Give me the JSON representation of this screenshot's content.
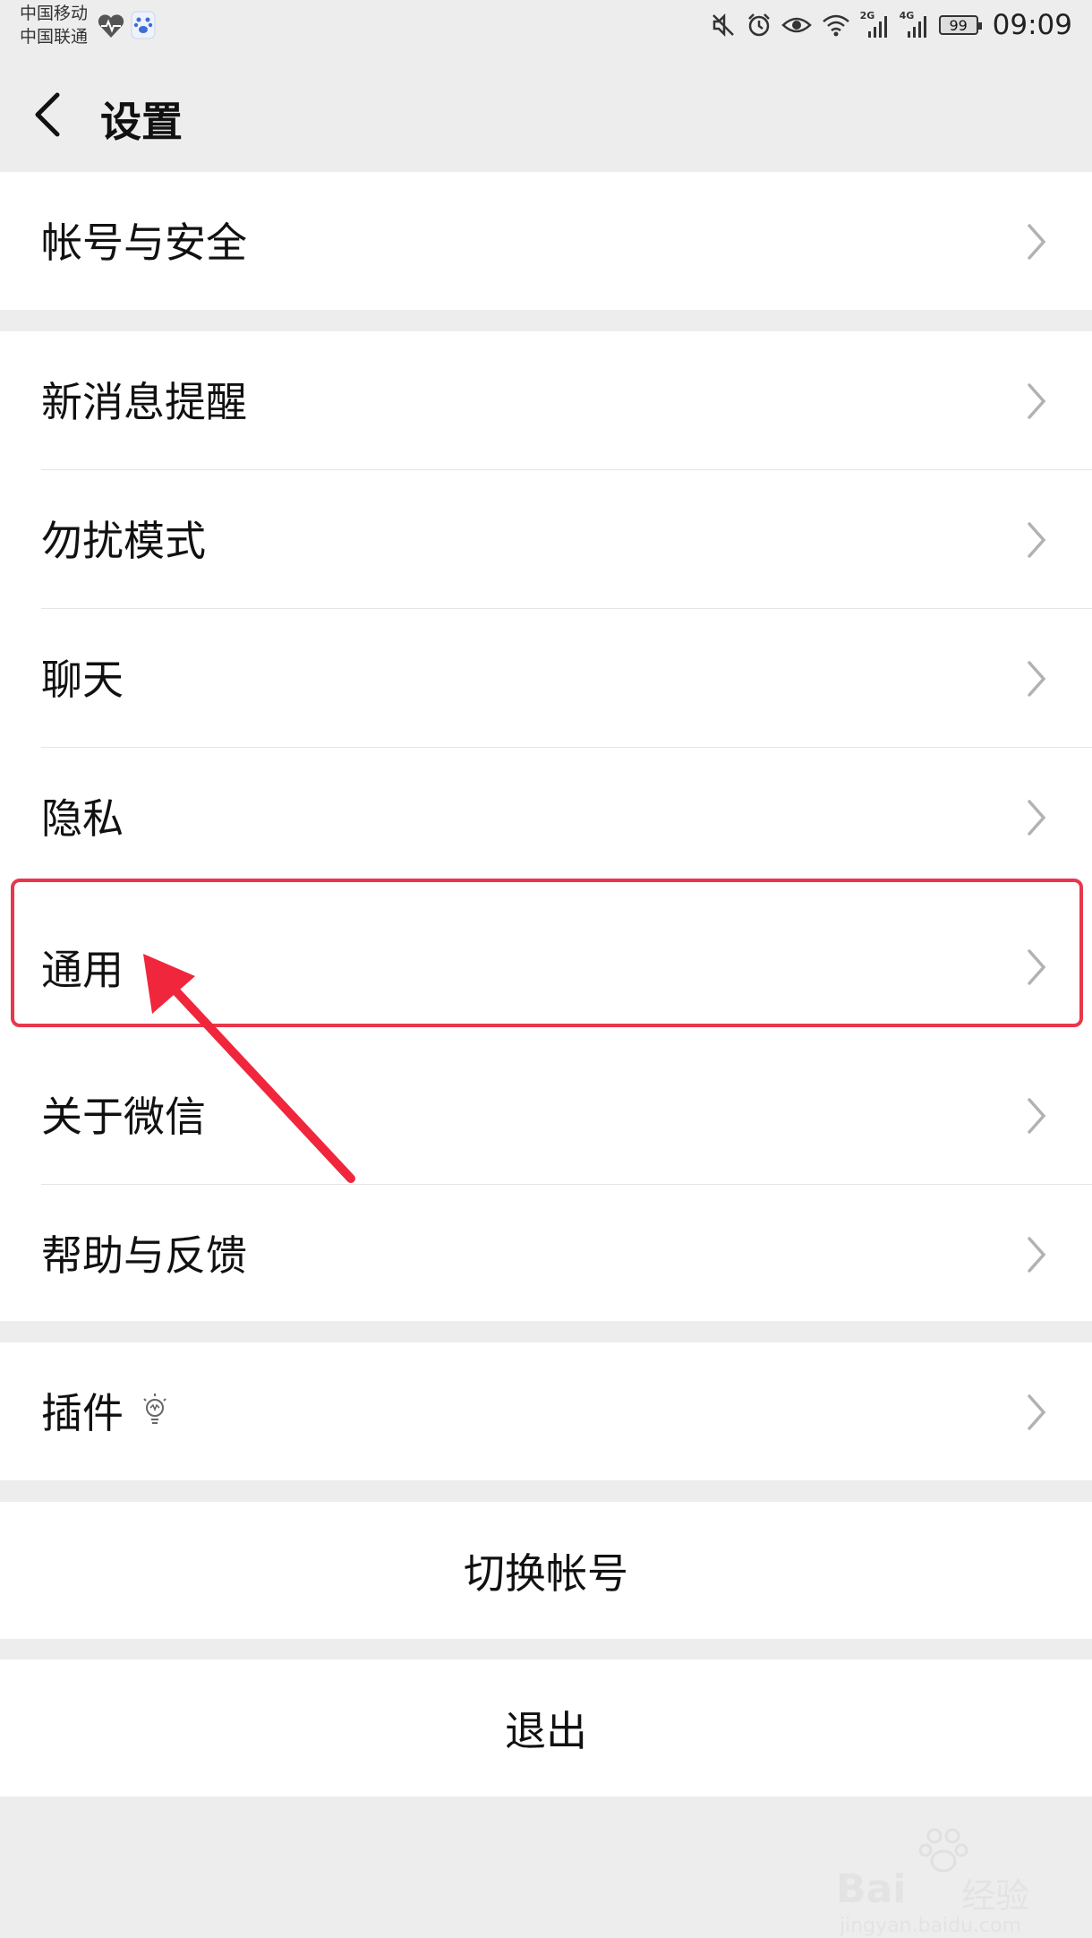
{
  "status_bar": {
    "carrier1": "中国移动",
    "carrier2": "中国联通",
    "net_2g": "2G",
    "net_4g": "4G",
    "battery": "99",
    "time": "09:09",
    "icons": [
      "health-icon",
      "baidu-paw-icon",
      "mute-icon",
      "alarm-icon",
      "eye-icon",
      "wifi-icon",
      "signal-icon",
      "battery-icon"
    ]
  },
  "nav": {
    "title": "设置"
  },
  "settings": {
    "account_security": "帐号与安全",
    "new_message_alert": "新消息提醒",
    "do_not_disturb": "勿扰模式",
    "chat": "聊天",
    "privacy": "隐私",
    "general": "通用",
    "about_wechat": "关于微信",
    "help_feedback": "帮助与反馈",
    "plugins": "插件",
    "switch_account": "切换帐号",
    "logout": "退出"
  },
  "annotation": {
    "highlight_color": "#e8374b",
    "highlighted_item": "通用"
  },
  "watermark": {
    "brand": "Bai",
    "brand_suffix": "经验",
    "url": "jingyan.baidu.com"
  }
}
